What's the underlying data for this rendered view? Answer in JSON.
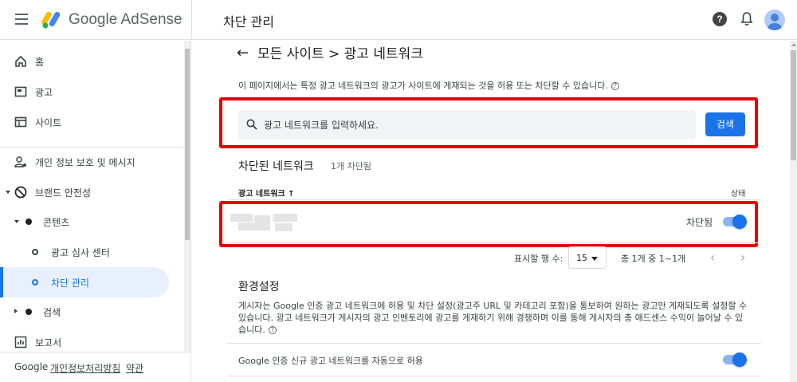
{
  "header": {
    "app_name": "Google AdSense",
    "page_title": "차단 관리",
    "help_glyph": "?"
  },
  "sidebar": {
    "items": [
      {
        "label": "홈",
        "icon": "home-icon"
      },
      {
        "label": "광고",
        "icon": "ad-icon"
      },
      {
        "label": "사이트",
        "icon": "sites-icon"
      },
      {
        "label": "개인 정보 보호 및 메시지",
        "icon": "privacy-icon"
      },
      {
        "label": "브랜드 안전성",
        "icon": "block-icon"
      },
      {
        "label": "콘텐츠"
      },
      {
        "label": "광고 심사 센터"
      },
      {
        "label": "차단 관리"
      },
      {
        "label": "검색"
      },
      {
        "label": "보고서",
        "icon": "reports-icon"
      }
    ],
    "footer": {
      "brand": "Google",
      "privacy": "개인정보처리방침",
      "terms": "약관"
    }
  },
  "main": {
    "back_glyph": "←",
    "breadcrumb": "모든 사이트 > 광고 네트워크",
    "description": "이 페이지에서는 특정 광고 네트워크의 광고가 사이트에 게재되는 것을 허용 또는 차단할 수 있습니다.",
    "search": {
      "placeholder": "광고 네트워크를 입력하세요.",
      "button": "검색"
    },
    "blocked": {
      "title": "차단된 네트워크",
      "count": "1개 차단됨",
      "col_network": "광고 네트워크  ↑",
      "col_status": "상태",
      "rows": [
        {
          "status": "차단됨",
          "blocked": true
        }
      ]
    },
    "pager": {
      "rows_label": "표시할 행 수:",
      "rows_value": "15",
      "range": "총 1개 중 1~1개",
      "prev": "‹",
      "next": "›"
    },
    "prefs": {
      "title": "환경설정",
      "description": "게시자는 Google 인증 광고 네트워크에 허용 및 차단 설정(광고주 URL 및 카테고리 포함)을 통보하여 원하는 광고만 게재되도록 설정할 수 있습니다. 광고 네트워크가 게시자의 광고 인벤토리에 광고를 게재하기 위해 경쟁하며 이를 통해 게시자의 총 애드센스 수익이 늘어날 수 있습니다.",
      "auto_allow_label": "Google 인증 신규 광고 네트워크를 자동으로 허용",
      "auto_allow_on": true
    }
  },
  "colors": {
    "accent": "#1a73e8",
    "highlight": "#e50000"
  }
}
